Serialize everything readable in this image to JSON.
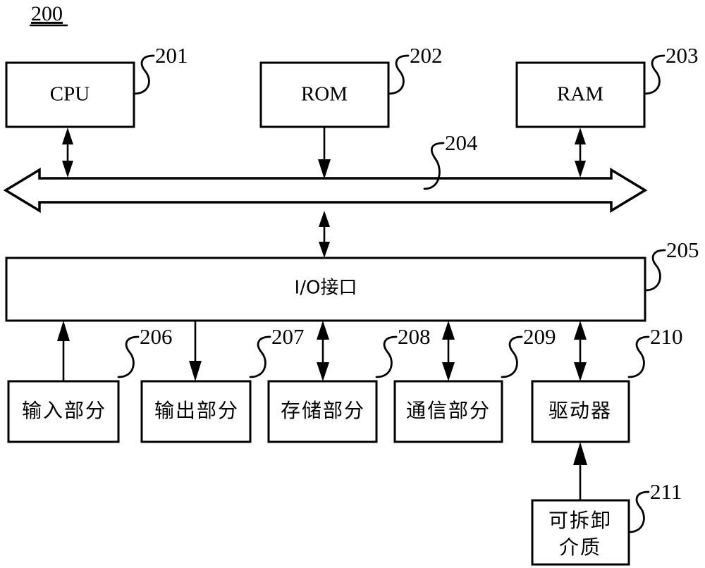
{
  "figure": {
    "number": "200",
    "title_underlined": true,
    "background_color": "#ffffff",
    "line_color": "#000000"
  },
  "blocks": [
    {
      "id": "cpu",
      "label": "CPU",
      "ref": "201",
      "multiline": false
    },
    {
      "id": "rom",
      "label": "ROM",
      "ref": "202",
      "multiline": false
    },
    {
      "id": "ram",
      "label": "RAM",
      "ref": "203",
      "multiline": false
    },
    {
      "id": "bus",
      "label": "",
      "ref": "204",
      "multiline": false
    },
    {
      "id": "io",
      "label": "I/O接口",
      "ref": "205",
      "multiline": false
    },
    {
      "id": "input",
      "label": "输入部分",
      "ref": "206",
      "multiline": false
    },
    {
      "id": "output",
      "label": "输出部分",
      "ref": "207",
      "multiline": false
    },
    {
      "id": "storage",
      "label": "存储部分",
      "ref": "208",
      "multiline": false
    },
    {
      "id": "comm",
      "label": "通信部分",
      "ref": "209",
      "multiline": false
    },
    {
      "id": "driver",
      "label": "驱动器",
      "ref": "210",
      "multiline": false
    },
    {
      "id": "media",
      "label_line1": "可拆卸",
      "label_line2": "介质",
      "label": "可拆卸介质",
      "ref": "211",
      "multiline": true
    }
  ],
  "refs": {
    "cpu": "201",
    "rom": "202",
    "ram": "203",
    "bus": "204",
    "io": "205",
    "input": "206",
    "output": "207",
    "storage": "208",
    "comm": "209",
    "driver": "210",
    "media": "211"
  },
  "labels": {
    "cpu": "CPU",
    "rom": "ROM",
    "ram": "RAM",
    "io": "I/O接口",
    "input": "输入部分",
    "output": "输出部分",
    "storage": "存储部分",
    "comm": "通信部分",
    "driver": "驱动器",
    "media_line1": "可拆卸",
    "media_line2": "介质"
  },
  "connections": [
    {
      "from": "cpu",
      "to": "bus",
      "direction": "bidirectional"
    },
    {
      "from": "rom",
      "to": "bus",
      "direction": "down"
    },
    {
      "from": "ram",
      "to": "bus",
      "direction": "bidirectional"
    },
    {
      "from": "bus",
      "to": "io",
      "direction": "bidirectional"
    },
    {
      "from": "io",
      "to": "input",
      "direction": "up"
    },
    {
      "from": "io",
      "to": "output",
      "direction": "down"
    },
    {
      "from": "io",
      "to": "storage",
      "direction": "bidirectional"
    },
    {
      "from": "io",
      "to": "comm",
      "direction": "bidirectional"
    },
    {
      "from": "io",
      "to": "driver",
      "direction": "bidirectional"
    },
    {
      "from": "media",
      "to": "driver",
      "direction": "up"
    }
  ]
}
